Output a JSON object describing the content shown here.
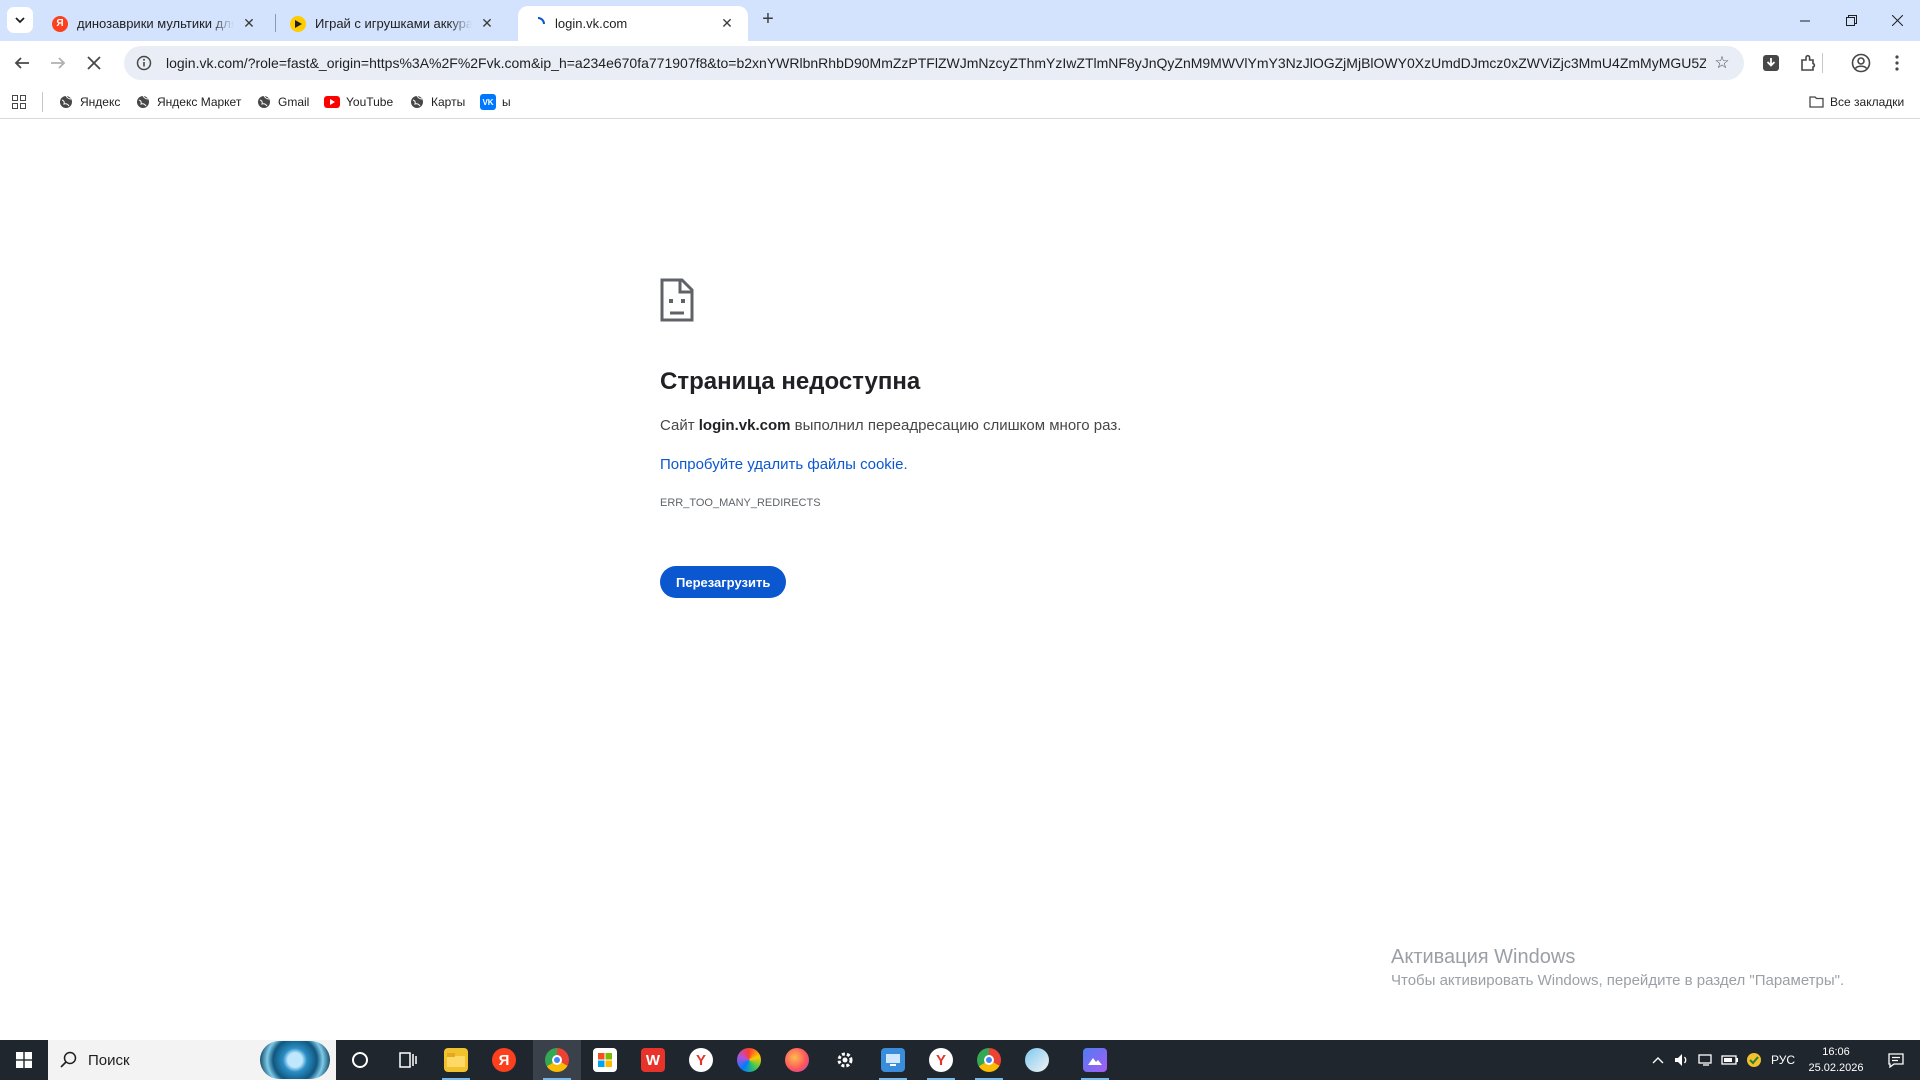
{
  "tabs": [
    {
      "title": "динозаврики мультики для детей",
      "favicon": "yandex-icon",
      "active": false
    },
    {
      "title": "Играй с игрушками аккуратно",
      "favicon": "play-icon",
      "active": false
    },
    {
      "title": "login.vk.com",
      "favicon": "loading-icon",
      "active": true
    }
  ],
  "toolbar": {
    "url": "login.vk.com/?role=fast&_origin=https%3A%2F%2Fvk.com&ip_h=a234e670fa771907f8&to=b2xnYWRlbnRhbD90MmZzPTFlZWJmNzcyZThmYzIwZTlmNF8yJnQyZnM9MWVlYmY3NzJlOGZjMjBlOWY0XzUmdDJmcz0xZWViZjc3MmU4ZmMyMGU5ZjRfO..."
  },
  "bookmarks": {
    "items": [
      {
        "label": "Яндекс"
      },
      {
        "label": "Яндекс Маркет"
      },
      {
        "label": "Gmail"
      },
      {
        "label": "YouTube"
      },
      {
        "label": "Карты"
      },
      {
        "label": "ы"
      }
    ],
    "all_label": "Все закладки"
  },
  "error": {
    "title": "Страница недоступна",
    "desc_prefix": "Сайт ",
    "desc_host": "login.vk.com",
    "desc_suffix": " выполнил переадресацию слишком много раз.",
    "link": "Попробуйте удалить файлы cookie.",
    "code": "ERR_TOO_MANY_REDIRECTS",
    "reload": "Перезагрузить"
  },
  "watermark": {
    "title": "Активация Windows",
    "subtitle": "Чтобы активировать Windows, перейдите в раздел \"Параметры\"."
  },
  "taskbar": {
    "search_placeholder": "Поиск",
    "language": "РУС",
    "time": "16:06",
    "date": "25.02.2026"
  },
  "colors": {
    "accent": "#0b57d0",
    "tabstrip": "#d3e3fd",
    "omnibox": "#e9eef6"
  }
}
